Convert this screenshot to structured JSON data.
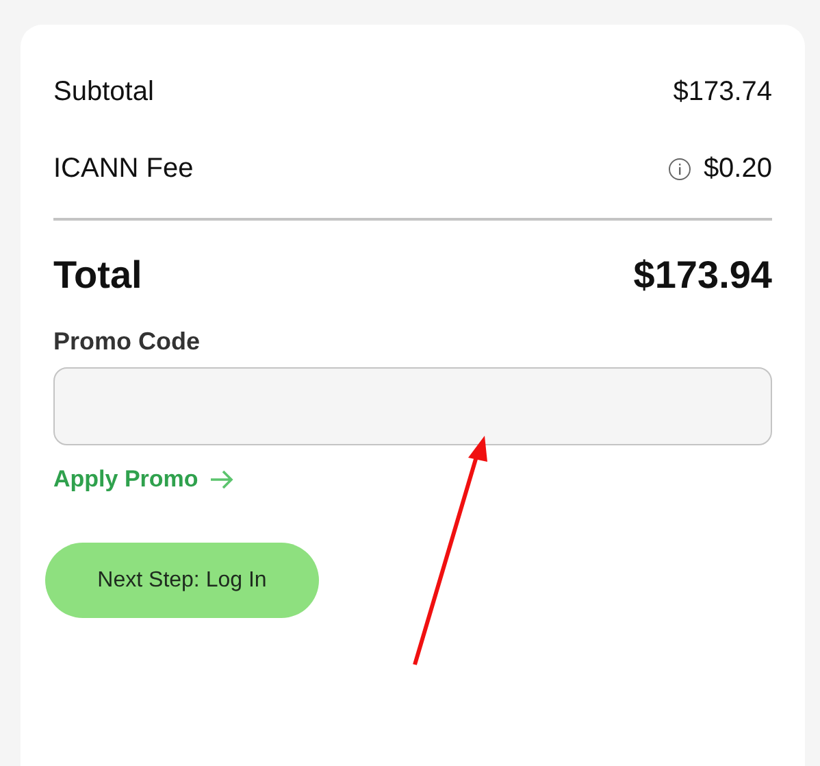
{
  "summary": {
    "lines": [
      {
        "label": "Subtotal",
        "amount": "$173.74",
        "info_icon": false
      },
      {
        "label": "ICANN Fee",
        "amount": "$0.20",
        "info_icon": true
      }
    ],
    "total": {
      "label": "Total",
      "amount": "$173.94"
    }
  },
  "promo": {
    "label": "Promo Code",
    "apply_link": "Apply Promo"
  },
  "next_button": "Next Step: Log In"
}
